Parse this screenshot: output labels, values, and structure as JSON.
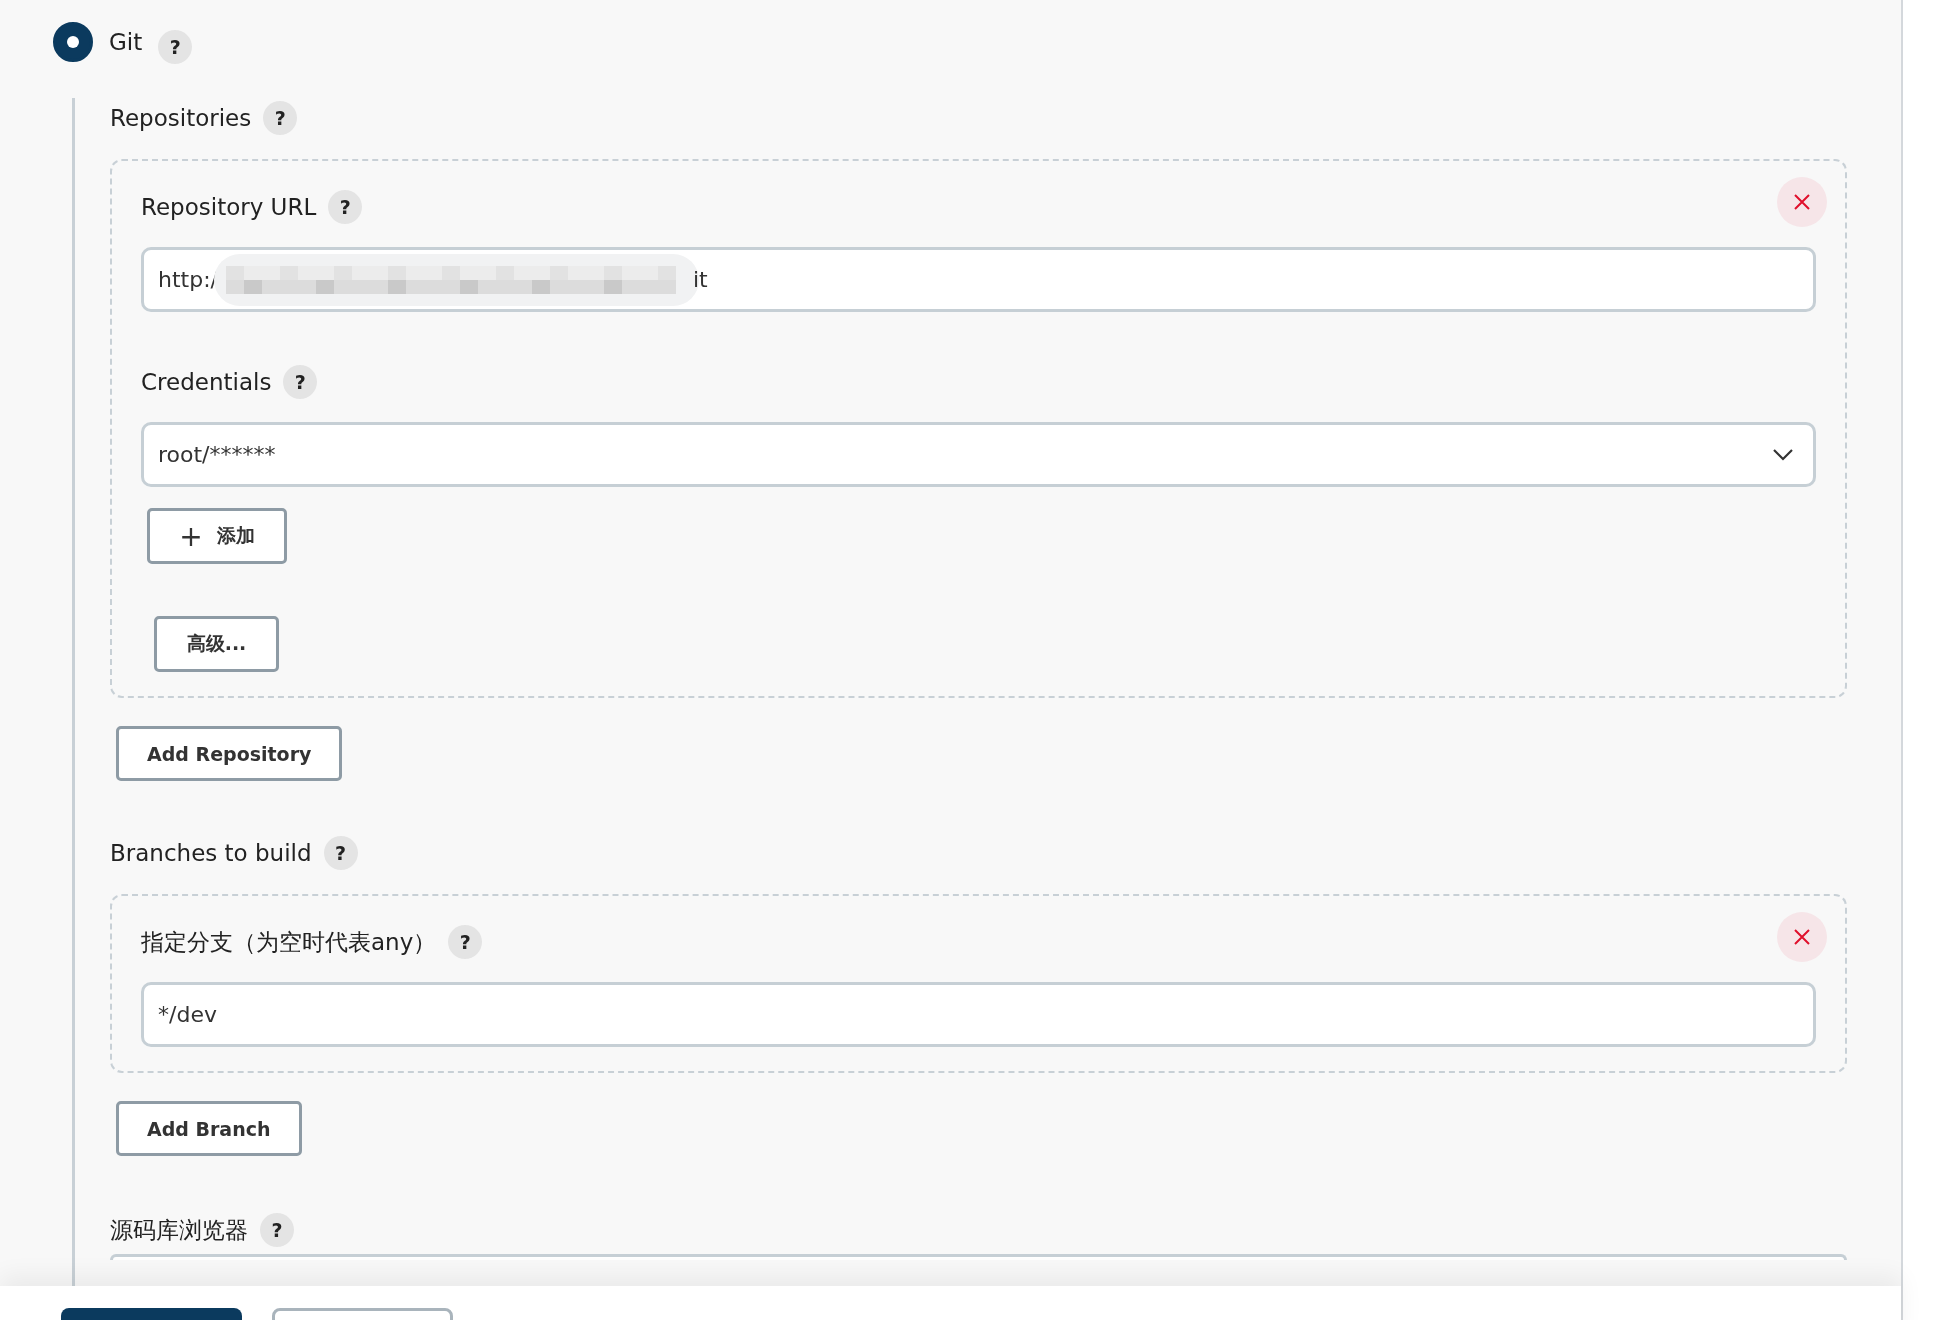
{
  "scm_option": {
    "label": "Git",
    "selected": true,
    "help": "?"
  },
  "repositories": {
    "label": "Repositories",
    "help": "?",
    "items": [
      {
        "url": {
          "label": "Repository URL",
          "help": "?",
          "value_start": "http:/",
          "value_end": "it",
          "redacted": true
        },
        "credentials": {
          "label": "Credentials",
          "help": "?",
          "value": "root/******"
        },
        "add_button": {
          "icon": "+",
          "label": "添加"
        },
        "advanced_button": "高级..."
      }
    ],
    "add_button": "Add Repository"
  },
  "branches": {
    "label": "Branches to build",
    "help": "?",
    "items": [
      {
        "label": "指定分支（为空时代表any）",
        "help": "?",
        "value": "*/dev"
      }
    ],
    "add_button": "Add Branch"
  },
  "browser": {
    "label": "源码库浏览器",
    "help": "?"
  },
  "bottom_bar": {
    "buttons": [
      {
        "kind": "primary"
      },
      {
        "kind": "secondary"
      }
    ]
  }
}
